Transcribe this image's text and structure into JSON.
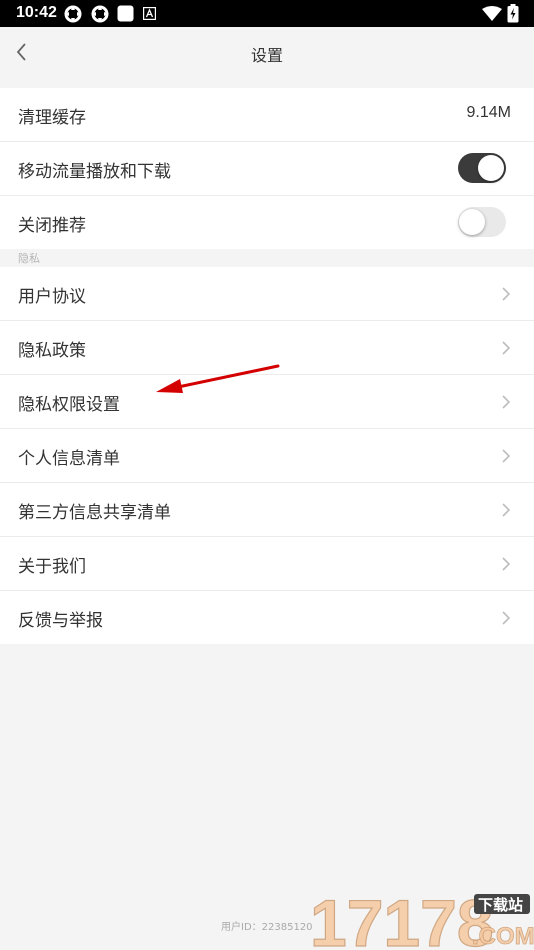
{
  "status_bar": {
    "time": "10:42",
    "left_icons": [
      "settings-gear-icon",
      "settings-gear-icon",
      "square-icon",
      "app-a-icon"
    ],
    "right_icons": [
      "wifi-icon",
      "battery-charging-icon"
    ]
  },
  "header": {
    "back_icon": "chevron-left-icon",
    "title": "设置"
  },
  "general_settings": [
    {
      "label": "清理缓存",
      "value": "9.14M"
    },
    {
      "label": "移动流量播放和下载",
      "toggle": true
    },
    {
      "label": "关闭推荐",
      "toggle": false
    }
  ],
  "privacy_section": {
    "label": "隐私",
    "items": [
      {
        "label": "用户协议"
      },
      {
        "label": "隐私政策"
      },
      {
        "label": "隐私权限设置"
      },
      {
        "label": "个人信息清单"
      },
      {
        "label": "第三方信息共享清单"
      },
      {
        "label": "关于我们"
      },
      {
        "label": "反馈与举报"
      }
    ]
  },
  "footer": {
    "user_id": "用户ID：22385120"
  },
  "watermark": {
    "number": "17178",
    "tag": "下载站",
    "domain": ".COM"
  },
  "colors": {
    "toggle_on": "#3b3b3b",
    "toggle_off": "#e9e9e9",
    "arrow": "#d40000",
    "chevron": "#bdbdbd"
  }
}
